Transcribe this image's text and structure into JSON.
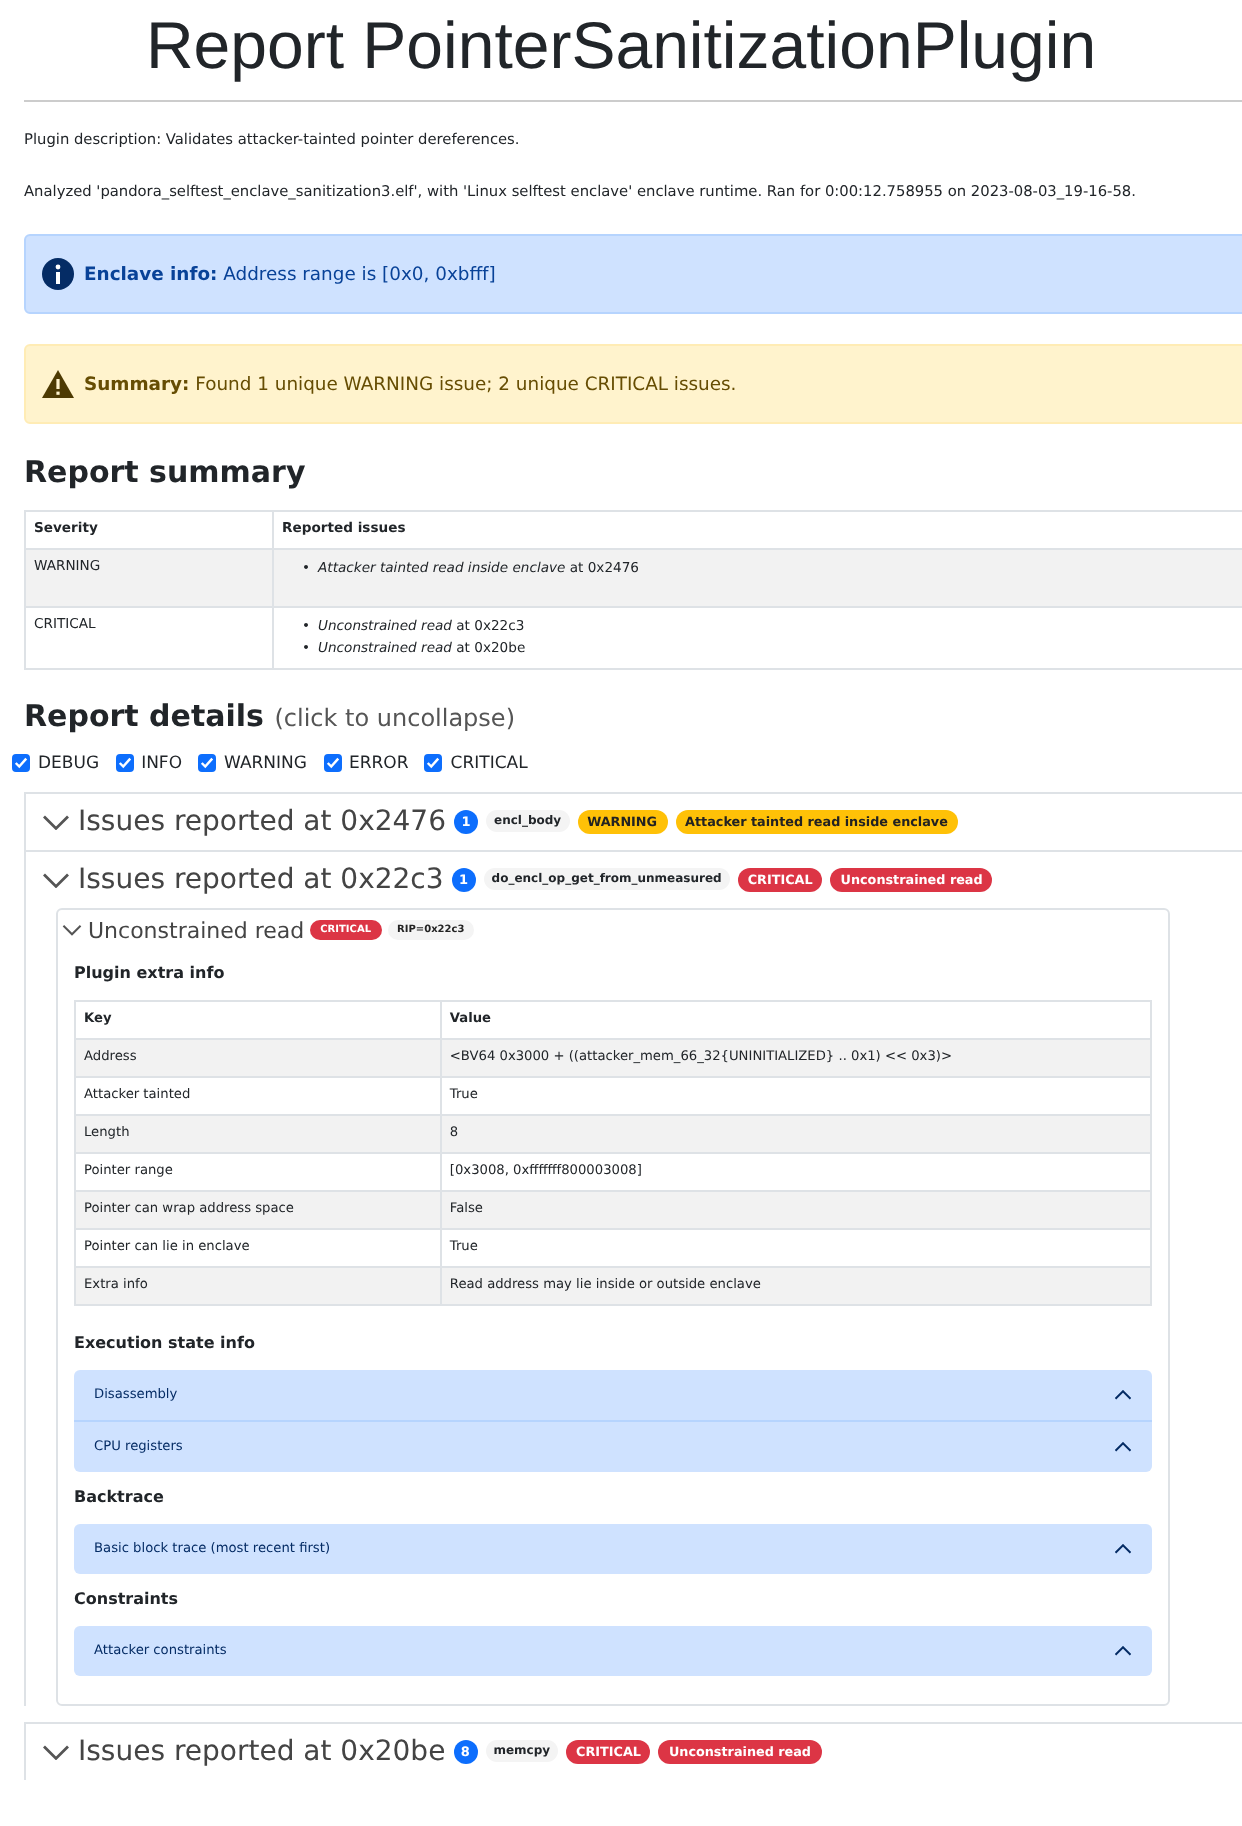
{
  "title": "Report PointerSanitizationPlugin",
  "description": "Plugin description: Validates attacker-tainted pointer dereferences.",
  "analyzed": "Analyzed 'pandora_selftest_enclave_sanitization3.elf', with 'Linux selftest enclave' enclave runtime. Ran for 0:00:12.758955 on 2023-08-03_19-16-58.",
  "alerts": [
    {
      "kind": "info",
      "label": "Enclave info:",
      "text": "Address range is [0x0, 0xbfff]"
    },
    {
      "kind": "warning",
      "label": "Summary:",
      "text": "Found 1 unique WARNING issue; 2 unique CRITICAL issues."
    }
  ],
  "report_summary": {
    "heading": "Report summary",
    "columns": [
      "Severity",
      "Reported issues"
    ],
    "rows": [
      {
        "severity": "WARNING",
        "issues": [
          {
            "marker": "•",
            "text": "*Attacker tainted read inside enclave* at 0x2476"
          }
        ]
      },
      {
        "severity": "CRITICAL",
        "issues": [
          {
            "marker": "•",
            "text": "*Unconstrained read* at 0x22c3"
          },
          {
            "marker": "•",
            "text": "*Unconstrained read* at 0x20be"
          }
        ]
      }
    ]
  },
  "report_details": {
    "heading": "Report details",
    "hint": "(click to uncollapse)"
  },
  "filters": [
    {
      "label": "DEBUG",
      "checked": true
    },
    {
      "label": "INFO",
      "checked": true
    },
    {
      "label": "WARNING",
      "checked": true
    },
    {
      "label": "ERROR",
      "checked": true
    },
    {
      "label": "CRITICAL",
      "checked": true
    }
  ],
  "issue_groups": [
    {
      "title": "Issues reported at 0x2476",
      "count": "1",
      "function": "encl_body",
      "badges": [
        {
          "text": "WARNING",
          "kind": "warning"
        },
        {
          "text": "Attacker tainted read inside enclave",
          "kind": "warning"
        }
      ]
    },
    {
      "title": "Issues reported at 0x22c3",
      "count": "1",
      "function": "do_encl_op_get_from_unmeasured",
      "badges": [
        {
          "text": "CRITICAL",
          "kind": "critical"
        },
        {
          "text": "Unconstrained read",
          "kind": "critical"
        }
      ],
      "reports": [
        {
          "title": "Unconstrained read",
          "badges": [
            {
              "text": "CRITICAL",
              "kind": "critical"
            },
            {
              "text": "RIP=0x22c3",
              "kind": "plain"
            }
          ],
          "sections": [
            {
              "kind": "table",
              "heading": "Plugin extra info",
              "columns": [
                "Key",
                "Value"
              ],
              "rows": [
                [
                  "Address",
                  "<BV64 0x3000 + ((attacker_mem_66_32{UNINITIALIZED} .. 0x1) << 0x3)>"
                ],
                [
                  "Attacker tainted",
                  "True"
                ],
                [
                  "Length",
                  "8"
                ],
                [
                  "Pointer range",
                  "[0x3008, 0xfffffff800003008]"
                ],
                [
                  "Pointer can wrap address space",
                  "False"
                ],
                [
                  "Pointer can lie in enclave",
                  "True"
                ],
                [
                  "Extra info",
                  "Read address may lie inside or outside enclave"
                ]
              ]
            },
            {
              "kind": "panels",
              "heading": "Execution state info",
              "panels": [
                "Disassembly",
                "CPU registers"
              ]
            },
            {
              "kind": "panels",
              "heading": "Backtrace",
              "panels": [
                "Basic block trace (most recent first)"
              ]
            },
            {
              "kind": "panels",
              "heading": "Constraints",
              "panels": [
                "Attacker constraints"
              ]
            }
          ]
        }
      ]
    },
    {
      "title": "Issues reported at 0x20be",
      "count": "8",
      "function": "memcpy",
      "badges": [
        {
          "text": "CRITICAL",
          "kind": "critical"
        },
        {
          "text": "Unconstrained read",
          "kind": "critical"
        }
      ]
    }
  ]
}
